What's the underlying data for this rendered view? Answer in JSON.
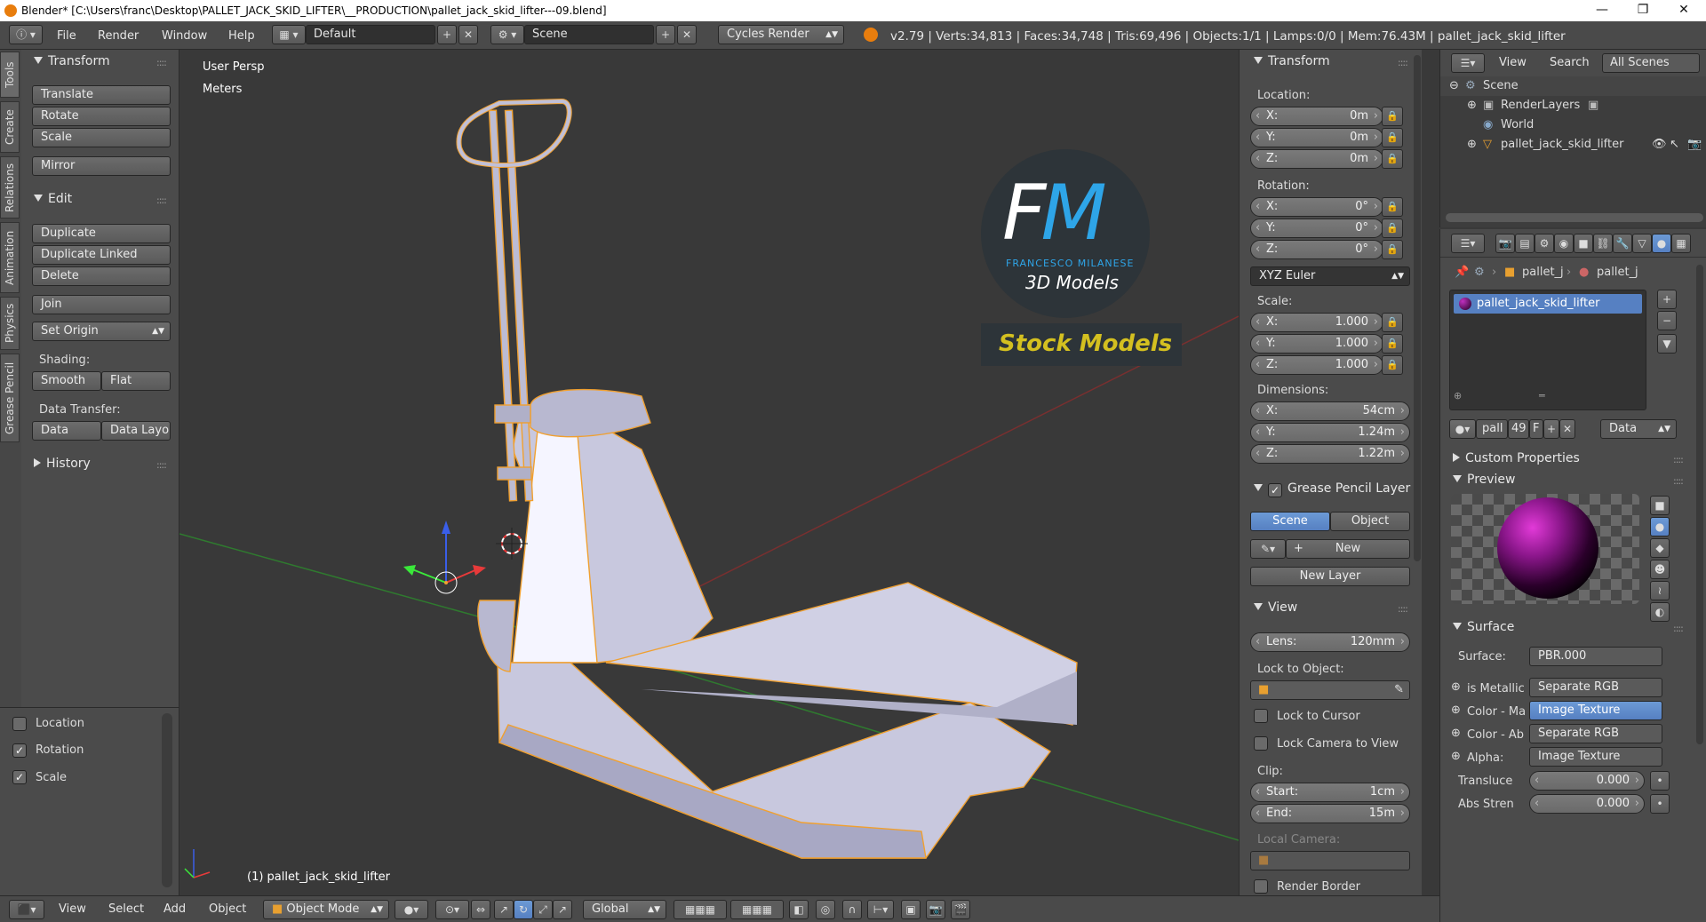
{
  "window": {
    "title": "Blender* [C:\\Users\\franc\\Desktop\\PALLET_JACK_SKID_LIFTER\\__PRODUCTION\\pallet_jack_skid_lifter---09.blend]"
  },
  "topbar": {
    "menus": [
      "File",
      "Render",
      "Window",
      "Help"
    ],
    "layout": "Default",
    "scene": "Scene",
    "engine": "Cycles Render",
    "stats": "v2.79 | Verts:34,813 | Faces:34,748 | Tris:69,496 | Objects:1/1 | Lamps:0/0 | Mem:76.43M | pallet_jack_skid_lifter"
  },
  "tool_tabs": [
    "Tools",
    "Create",
    "Relations",
    "Animation",
    "Physics",
    "Grease Pencil"
  ],
  "tools": {
    "transform_header": "Transform",
    "translate": "Translate",
    "rotate": "Rotate",
    "scale": "Scale",
    "mirror": "Mirror",
    "edit_header": "Edit",
    "duplicate": "Duplicate",
    "duplicate_linked": "Duplicate Linked",
    "delete": "Delete",
    "join": "Join",
    "set_origin": "Set Origin",
    "shading_label": "Shading:",
    "smooth": "Smooth",
    "flat": "Flat",
    "data_transfer_label": "Data Transfer:",
    "data": "Data",
    "data_layo": "Data Layo",
    "history_header": "History",
    "opt_location": "Location",
    "opt_rotation": "Rotation",
    "opt_scale": "Scale"
  },
  "viewport": {
    "view_name": "User Persp",
    "units": "Meters",
    "object_label": "(1) pallet_jack_skid_lifter",
    "watermark": {
      "fm": "FM",
      "name": "FRANCESCO MILANESE",
      "models": "3D Models",
      "stock": "Stock Models"
    }
  },
  "properties_n": {
    "transform_header": "Transform",
    "location_label": "Location:",
    "location": [
      {
        "k": "X:",
        "v": "0m"
      },
      {
        "k": "Y:",
        "v": "0m"
      },
      {
        "k": "Z:",
        "v": "0m"
      }
    ],
    "rotation_label": "Rotation:",
    "rotation": [
      {
        "k": "X:",
        "v": "0°"
      },
      {
        "k": "Y:",
        "v": "0°"
      },
      {
        "k": "Z:",
        "v": "0°"
      }
    ],
    "rotation_mode": "XYZ Euler",
    "scale_label": "Scale:",
    "scale": [
      {
        "k": "X:",
        "v": "1.000"
      },
      {
        "k": "Y:",
        "v": "1.000"
      },
      {
        "k": "Z:",
        "v": "1.000"
      }
    ],
    "dimensions_label": "Dimensions:",
    "dimensions": [
      {
        "k": "X:",
        "v": "54cm"
      },
      {
        "k": "Y:",
        "v": "1.24m"
      },
      {
        "k": "Z:",
        "v": "1.22m"
      }
    ],
    "grease_header": "Grease Pencil Layer",
    "scene_btn": "Scene",
    "object_btn": "Object",
    "new_btn": "New",
    "new_layer_btn": "New Layer",
    "view_header": "View",
    "lens_k": "Lens:",
    "lens_v": "120mm",
    "lock_to_object": "Lock to Object:",
    "lock_to_cursor": "Lock to Cursor",
    "lock_camera": "Lock Camera to View",
    "clip_label": "Clip:",
    "clip_start_k": "Start:",
    "clip_start_v": "1cm",
    "clip_end_k": "End:",
    "clip_end_v": "15m",
    "local_camera": "Local Camera:",
    "render_border": "Render Border"
  },
  "outliner": {
    "view": "View",
    "search": "Search",
    "filter": "All Scenes",
    "items": [
      "Scene",
      "RenderLayers",
      "World",
      "pallet_jack_skid_lifter"
    ]
  },
  "material": {
    "breadcrumb1": "pallet_j",
    "breadcrumb2": "pallet_j",
    "slot": "pallet_jack_skid_lifter",
    "mat_name": "pall",
    "users": "49",
    "fake": "F",
    "link": "Data",
    "custom_props": "Custom Properties",
    "preview": "Preview",
    "surface_header": "Surface",
    "surface_label": "Surface:",
    "surface_value": "PBR.000",
    "rows": [
      {
        "k": "is Metallic",
        "v": "Separate RGB",
        "sel": false
      },
      {
        "k": "Color - Ma",
        "v": "Image Texture",
        "sel": true
      },
      {
        "k": "Color - Ab",
        "v": "Separate RGB",
        "sel": false
      },
      {
        "k": "Alpha:",
        "v": "Image Texture",
        "sel": false
      }
    ],
    "transluce_k": "Transluce",
    "transluce_v": "0.000",
    "abs_k": "Abs Stren",
    "abs_v": "0.000"
  },
  "bottombar": {
    "view": "View",
    "select": "Select",
    "add": "Add",
    "object": "Object",
    "mode": "Object Mode",
    "orientation": "Global"
  },
  "colors": {
    "accent": "#5680c2",
    "selection_outline": "#f0a030",
    "viewport_bg": "#393939"
  }
}
